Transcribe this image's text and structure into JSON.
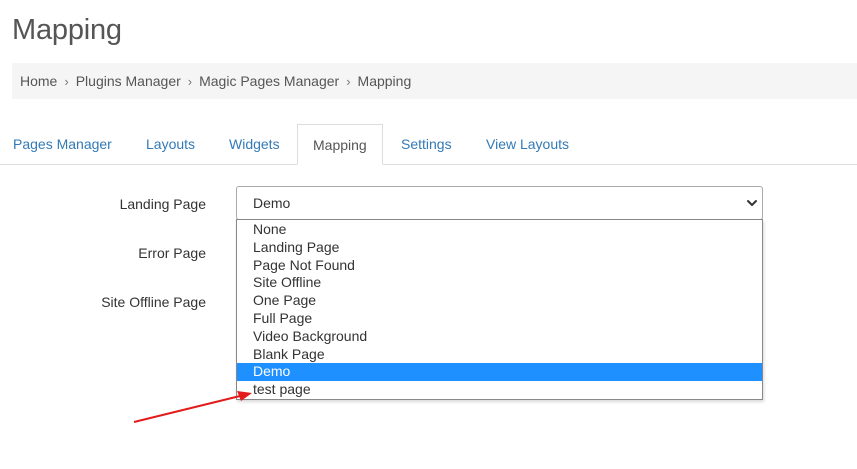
{
  "page": {
    "title": "Mapping"
  },
  "breadcrumb": {
    "items": [
      "Home",
      "Plugins Manager",
      "Magic Pages Manager",
      "Mapping"
    ],
    "separator": "›"
  },
  "tabs": [
    {
      "label": "Pages Manager",
      "active": false
    },
    {
      "label": "Layouts",
      "active": false
    },
    {
      "label": "Widgets",
      "active": false
    },
    {
      "label": "Mapping",
      "active": true
    },
    {
      "label": "Settings",
      "active": false
    },
    {
      "label": "View Layouts",
      "active": false
    }
  ],
  "form": {
    "landing_label": "Landing Page",
    "error_label": "Error Page",
    "offline_label": "Site Offline Page",
    "landing_selected": "Demo"
  },
  "dropdown": {
    "options": [
      "None",
      "Landing Page",
      "Page Not Found",
      "Site Offline",
      "One Page",
      "Full Page",
      "Video Background",
      "Blank Page",
      "Demo",
      "test page"
    ],
    "highlighted": "Demo"
  },
  "colors": {
    "link": "#337ab7",
    "highlight": "#1e90ff",
    "annotation_arrow": "#e31b1b"
  },
  "icons": {
    "select_caret": "chevron-down-icon",
    "annotation": "red-arrow"
  }
}
